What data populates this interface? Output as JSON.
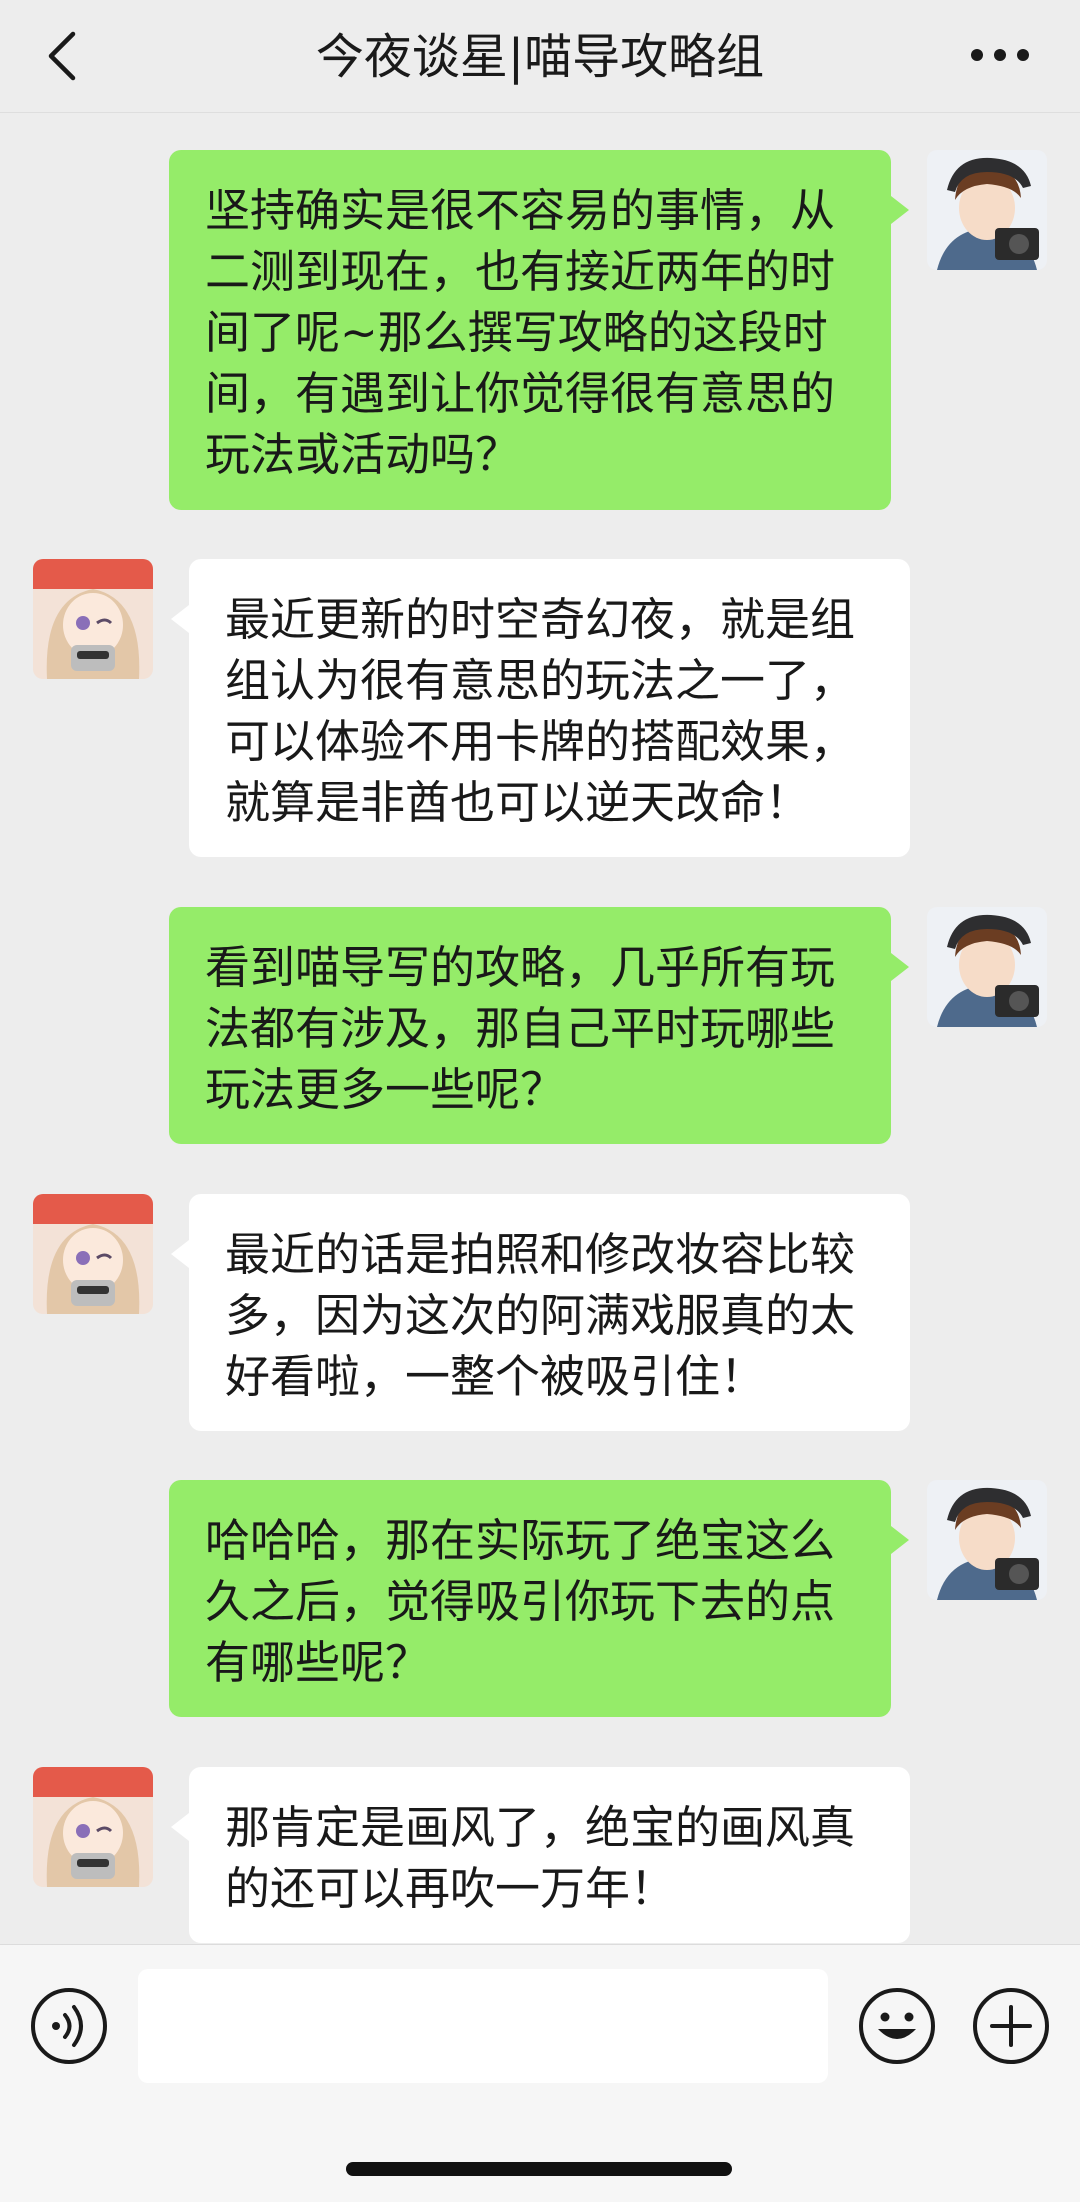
{
  "header": {
    "title": "今夜谈星|喵导攻略组",
    "back_icon": "chevron-left-icon",
    "more_icon": "more-dots-icon"
  },
  "messages": [
    {
      "side": "right",
      "sender": "interviewer",
      "text": "坚持确实是很不容易的事情，从二测到现在，也有接近两年的时间了呢~那么撰写攻略的这段时间，有遇到让你觉得很有意思的玩法或活动吗？"
    },
    {
      "side": "left",
      "sender": "guide",
      "text": "最近更新的时空奇幻夜，就是组组认为很有意思的玩法之一了，可以体验不用卡牌的搭配效果，就算是非酋也可以逆天改命！"
    },
    {
      "side": "right",
      "sender": "interviewer",
      "text": "看到喵导写的攻略，几乎所有玩法都有涉及，那自己平时玩哪些玩法更多一些呢？"
    },
    {
      "side": "left",
      "sender": "guide",
      "text": "最近的话是拍照和修改妆容比较多，因为这次的阿满戏服真的太好看啦，一整个被吸引住！"
    },
    {
      "side": "right",
      "sender": "interviewer",
      "text": "哈哈哈，那在实际玩了绝宝这么久之后，觉得吸引你玩下去的点有哪些呢？"
    },
    {
      "side": "left",
      "sender": "guide",
      "text": "那肯定是画风了，绝宝的画风真的还可以再吹一万年！"
    }
  ],
  "input": {
    "value": "",
    "placeholder": ""
  },
  "colors": {
    "outgoing_bubble": "#95ec69",
    "incoming_bubble": "#ffffff",
    "background": "#ededed"
  }
}
